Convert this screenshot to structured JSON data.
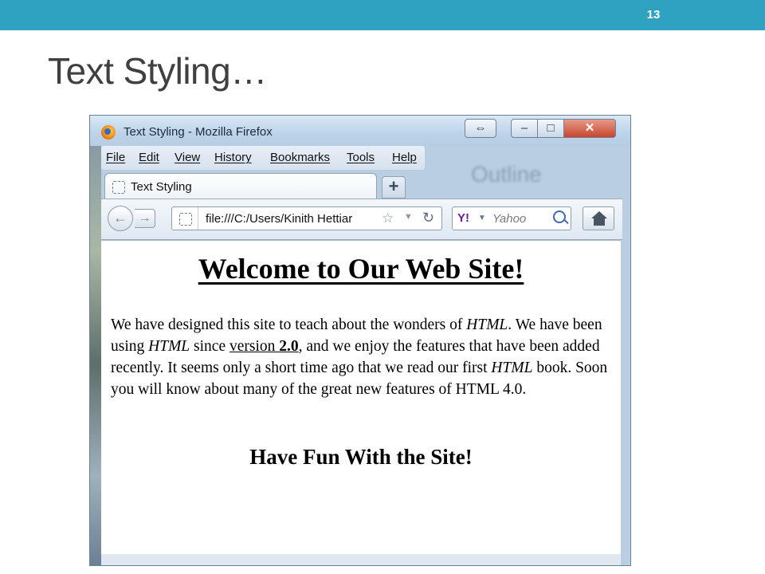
{
  "slide": {
    "number": "13",
    "title": "Text Styling…"
  },
  "window": {
    "title": "Text Styling - Mozilla Firefox",
    "close_label": "✕",
    "restore_alt_label": "⇔",
    "min_label": "–",
    "max_label": "□"
  },
  "menu": {
    "items": [
      "File",
      "Edit",
      "View",
      "History",
      "Bookmarks",
      "Tools",
      "Help"
    ]
  },
  "background_text": "Outline",
  "tab": {
    "label": "Text Styling",
    "new_tab_label": "+"
  },
  "nav": {
    "back_label": "←",
    "forward_label": "→",
    "url": "file:///C:/Users/Kinith Hettiar",
    "star_label": "☆",
    "dropdown_label": "▼",
    "reload_label": "↻",
    "search_provider": "Y!",
    "search_placeholder": "Yahoo"
  },
  "page": {
    "heading": "Welcome to Our Web Site!",
    "para_parts": {
      "p1": "We have designed this site to teach about the wonders of ",
      "em1": "HTML",
      "p2": ". We have been using ",
      "em2": "HTML",
      "p3": " since ",
      "u1": "version ",
      "b1": "2.0",
      "p4": ", and we enjoy the features that have been added recently. It seems only a short time ago that we read our first ",
      "em3": "HTML",
      "p5": " book. Soon you will know about many of the great new features of HTML 4.0."
    },
    "subheading": "Have Fun With the Site!"
  },
  "colors": {
    "slide_accent": "#2fa2c2",
    "title_text": "#404040",
    "window_frame": "#b9cee0"
  }
}
